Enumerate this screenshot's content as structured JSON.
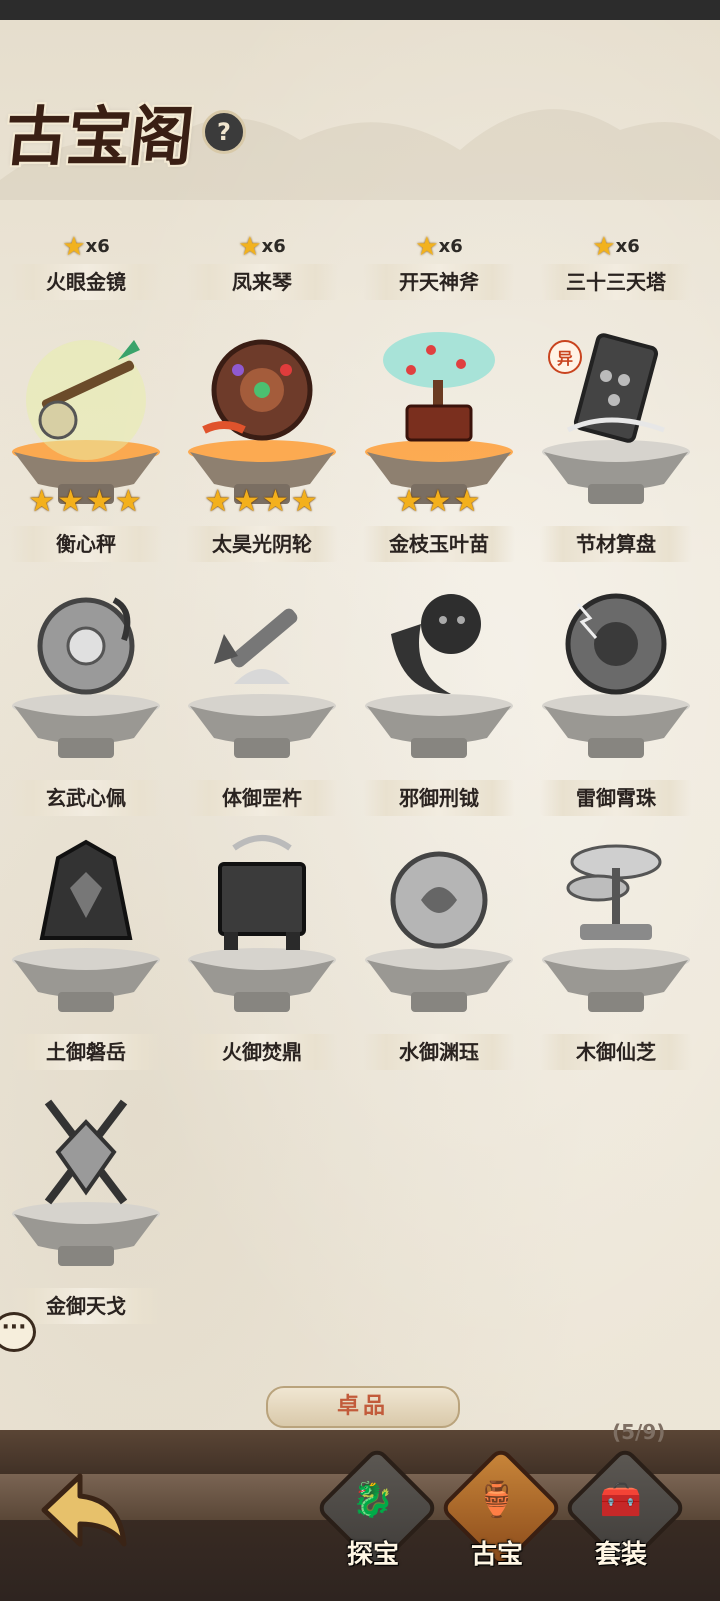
{
  "header": {
    "title": "古宝阁",
    "help_icon": "?"
  },
  "top_row": [
    {
      "stars_count": "x6",
      "name": "火眼金镜"
    },
    {
      "stars_count": "x6",
      "name": "凤来琴"
    },
    {
      "stars_count": "x6",
      "name": "开天神斧"
    },
    {
      "stars_count": "x6",
      "name": "三十三天塔"
    }
  ],
  "treasures": [
    {
      "name": "衡心秤",
      "stars": "★★★★",
      "colored": true
    },
    {
      "name": "太昊光阴轮",
      "stars": "★★★★",
      "colored": true
    },
    {
      "name": "金枝玉叶苗",
      "stars": "★★★",
      "colored": true
    },
    {
      "name": "节材算盘",
      "badge": "异",
      "colored": false
    },
    {
      "name": "玄武心佩"
    },
    {
      "name": "体御罡杵"
    },
    {
      "name": "邪御刑钺"
    },
    {
      "name": "雷御霄珠"
    },
    {
      "name": "土御磐岳"
    },
    {
      "name": "火御焚鼎"
    },
    {
      "name": "水御渊珏"
    },
    {
      "name": "木御仙芝"
    },
    {
      "name": "金御天戈"
    }
  ],
  "grade_banner": "卓品",
  "count": "(5/9)",
  "chat_icon": "···",
  "tabs": [
    {
      "label": "探宝",
      "icon": "dragon-icon"
    },
    {
      "label": "古宝",
      "icon": "cauldron-icon"
    },
    {
      "label": "套装",
      "icon": "chest-icon"
    }
  ],
  "colors": {
    "star": "#f3b01c",
    "active_tab": "#c9863a",
    "title": "#3a1f14"
  }
}
